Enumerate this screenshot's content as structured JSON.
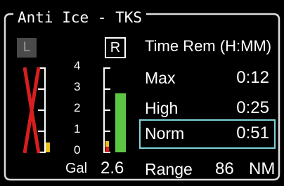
{
  "window": {
    "title": "Anti Ice - TKS"
  },
  "tanks": {
    "left_label": "L",
    "right_label": "R",
    "left_failed": true,
    "scale_labels": [
      "4",
      "3",
      "2",
      "1",
      "0"
    ],
    "unit": "Gal",
    "quantity": "2.6",
    "right_level_fraction": 0.625,
    "left_level_fraction": 0.06,
    "colors": {
      "green": "#5cc644",
      "yellow": "#e8c020",
      "red": "#d81e1e"
    }
  },
  "time_remaining": {
    "header": "Time Rem (H:MM)",
    "rows": [
      {
        "label": "Max",
        "value": "0:12"
      },
      {
        "label": "High",
        "value": "0:25"
      },
      {
        "label": "Norm",
        "value": "0:51",
        "selected": true
      }
    ],
    "range_label": "Range",
    "range_value": "86",
    "range_unit": "NM",
    "highlight_color": "#7fd4d8"
  }
}
